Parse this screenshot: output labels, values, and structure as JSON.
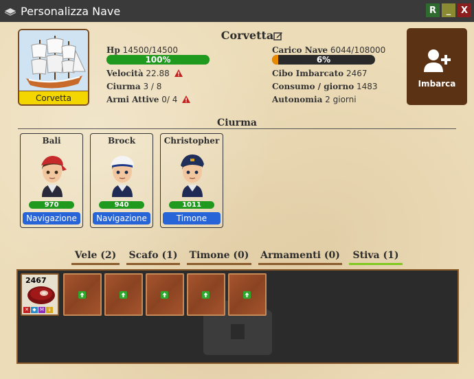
{
  "window": {
    "title": "Personalizza Nave",
    "buttons": {
      "r": "R",
      "minimize": "_",
      "close": "X"
    }
  },
  "ship": {
    "name": "Corvetta",
    "card_label": "Corvetta",
    "stats_left": {
      "hp_label": "Hp",
      "hp_value": "14500/14500",
      "hp_percent_text": "100%",
      "hp_fraction": 1.0,
      "speed_label": "Velocità",
      "speed_value": "22.88",
      "crew_label": "Ciurma",
      "crew_value": "3 / 8",
      "weapons_label": "Armi Attive",
      "weapons_value": "0/ 4"
    },
    "stats_right": {
      "cargo_label": "Carico Nave",
      "cargo_value": "6044/108000",
      "cargo_percent_text": "6%",
      "cargo_fraction": 0.06,
      "food_label": "Cibo Imbarcato",
      "food_value": "2467",
      "consumption_label": "Consumo / giorno",
      "consumption_value": "1483",
      "autonomy_label": "Autonomia",
      "autonomy_value": "2 giorni"
    }
  },
  "embark_button": {
    "label": "Imbarca",
    "icon": "user-plus-icon"
  },
  "crew": {
    "title": "Ciurma",
    "members": [
      {
        "name": "Bali",
        "xp": "970",
        "role": "Navigazione"
      },
      {
        "name": "Brock",
        "xp": "940",
        "role": "Navigazione"
      },
      {
        "name": "Christopher",
        "xp": "1011",
        "role": "Timone"
      }
    ]
  },
  "tabs": [
    {
      "label": "Vele (2)"
    },
    {
      "label": "Scafo (1)"
    },
    {
      "label": "Timone (0)"
    },
    {
      "label": "Armamenti (0)"
    },
    {
      "label": "Stiva (1)"
    }
  ],
  "inventory": {
    "item": {
      "quantity": "2467",
      "icon": "meat-icon"
    },
    "empty_slot_icon": "upload-arrow-icon"
  },
  "colors": {
    "titlebar": "#3a3a3a",
    "hp_bar": "#1f9a1f",
    "cargo_bar": "#e88a00",
    "embark_bg": "#5b3214",
    "role_badge": "#2764d8",
    "active_tab": "#7ec820"
  }
}
